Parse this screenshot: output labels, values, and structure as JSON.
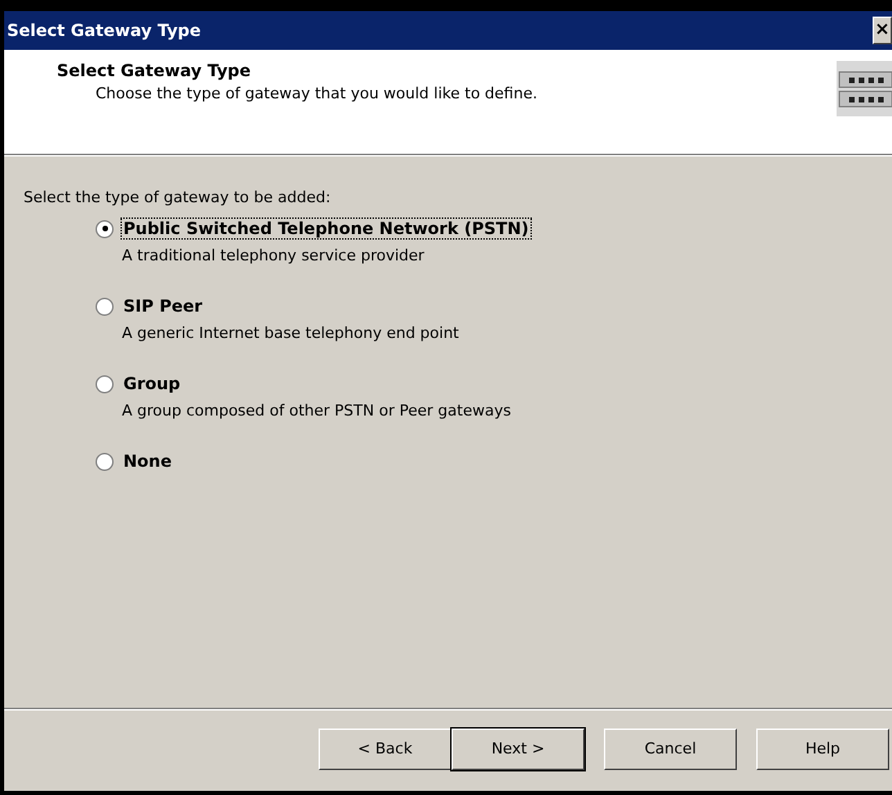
{
  "window": {
    "title": "Select Gateway Type",
    "close": "×"
  },
  "header": {
    "title": "Select Gateway Type",
    "subtitle": "Choose the type of gateway that you would like to define."
  },
  "prompt": "Select the type of gateway to be added:",
  "options": [
    {
      "label": "Public Switched Telephone Network (PSTN)",
      "description": "A traditional telephony service provider",
      "selected": true
    },
    {
      "label": "SIP Peer",
      "description": "A generic Internet base telephony end point",
      "selected": false
    },
    {
      "label": "Group",
      "description": "A group composed of other PSTN or Peer gateways",
      "selected": false
    },
    {
      "label": "None",
      "selected": false
    }
  ],
  "buttons": [
    {
      "label": "< Back",
      "default": false
    },
    {
      "label": "Next >",
      "default": true
    },
    {
      "label": "Cancel",
      "default": false
    },
    {
      "label": "Help",
      "default": false
    }
  ]
}
